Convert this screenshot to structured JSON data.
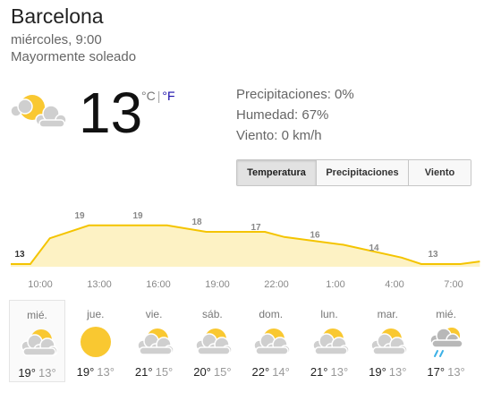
{
  "location": "Barcelona",
  "datetime": "miércoles, 9:00",
  "condition": "Mayormente soleado",
  "current": {
    "temperature": "13",
    "unit_c": "°C",
    "unit_separator": "|",
    "unit_f": "°F",
    "icon": "partly-sunny-icon"
  },
  "details": {
    "precipitation": "Precipitaciones: 0%",
    "humidity": "Humedad: 67%",
    "wind": "Viento: 0 km/h"
  },
  "tabs": [
    {
      "label": "Temperatura",
      "active": true
    },
    {
      "label": "Precipitaciones",
      "active": false
    },
    {
      "label": "Viento",
      "active": false
    }
  ],
  "colors": {
    "line": "#f4c400",
    "fill": "#fdf2c4",
    "sun": "#f9c831",
    "cloud": "#cfcfcf",
    "rain": "#3cb0e6"
  },
  "chart_data": {
    "type": "area",
    "x": [
      "10:00",
      "13:00",
      "16:00",
      "19:00",
      "22:00",
      "1:00",
      "4:00",
      "7:00"
    ],
    "labels": [
      "13",
      "19",
      "19",
      "18",
      "17",
      "16",
      "14",
      "13"
    ],
    "points": [
      {
        "t": "8:00",
        "v": 13
      },
      {
        "t": "9:00",
        "v": 13
      },
      {
        "t": "10:00",
        "v": 17
      },
      {
        "t": "12:00",
        "v": 19
      },
      {
        "t": "13:00",
        "v": 19
      },
      {
        "t": "16:00",
        "v": 19
      },
      {
        "t": "18:00",
        "v": 18
      },
      {
        "t": "21:00",
        "v": 18
      },
      {
        "t": "22:00",
        "v": 17.2
      },
      {
        "t": "1:00",
        "v": 16
      },
      {
        "t": "4:00",
        "v": 14
      },
      {
        "t": "5:00",
        "v": 13
      },
      {
        "t": "7:00",
        "v": 13
      },
      {
        "t": "8:00",
        "v": 13.4
      }
    ],
    "series": [
      {
        "name": "Temperatura"
      }
    ]
  },
  "forecast": [
    {
      "day": "mié.",
      "high": "19°",
      "low": "13°",
      "icon": "partly-cloudy-icon",
      "selected": true
    },
    {
      "day": "jue.",
      "high": "19°",
      "low": "13°",
      "icon": "sunny-icon",
      "selected": false
    },
    {
      "day": "vie.",
      "high": "21°",
      "low": "15°",
      "icon": "partly-cloudy-icon",
      "selected": false
    },
    {
      "day": "sáb.",
      "high": "20°",
      "low": "15°",
      "icon": "partly-cloudy-icon",
      "selected": false
    },
    {
      "day": "dom.",
      "high": "22°",
      "low": "14°",
      "icon": "partly-cloudy-icon",
      "selected": false
    },
    {
      "day": "lun.",
      "high": "21°",
      "low": "13°",
      "icon": "partly-cloudy-icon",
      "selected": false
    },
    {
      "day": "mar.",
      "high": "19°",
      "low": "13°",
      "icon": "partly-cloudy-icon",
      "selected": false
    },
    {
      "day": "mié.",
      "high": "17°",
      "low": "13°",
      "icon": "rain-icon",
      "selected": false
    }
  ]
}
